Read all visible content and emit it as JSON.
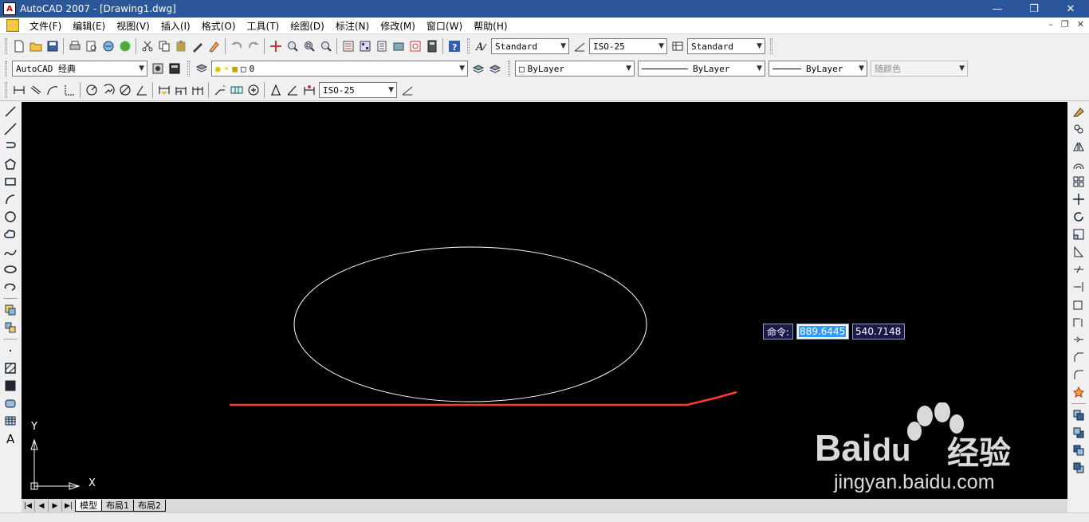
{
  "window": {
    "title": "AutoCAD 2007 - [Drawing1.dwg]",
    "app_icon_text": "A",
    "controls": {
      "minimize": "—",
      "maximize": "❐",
      "close": "✕"
    },
    "mdi_controls": {
      "minimize": "–",
      "restore": "❐",
      "close": "✕"
    }
  },
  "menu": {
    "items": [
      "文件(F)",
      "编辑(E)",
      "视图(V)",
      "插入(I)",
      "格式(O)",
      "工具(T)",
      "绘图(D)",
      "标注(N)",
      "修改(M)",
      "窗口(W)",
      "帮助(H)"
    ]
  },
  "toolbar_styles": {
    "text_style": "Standard",
    "dim_style": "ISO-25",
    "table_style": "Standard"
  },
  "toolbar_workspace": {
    "workspace": "AutoCAD 经典",
    "layer": "0",
    "color": "ByLayer",
    "linetype": "ByLayer",
    "lineweight": "ByLayer",
    "plotstyle": "随颜色"
  },
  "toolbar_dim": {
    "dim_style": "ISO-25"
  },
  "canvas": {
    "command_label": "命令:",
    "coord_x": "889.6445",
    "coord_y": "540.7148",
    "ucs_x": "X",
    "ucs_y": "Y",
    "ellipse_color": "#ffffff",
    "polyline_color": "#ff3b30",
    "background": "#000000"
  },
  "tabs": {
    "nav": [
      "|◀",
      "◀",
      "▶",
      "▶|"
    ],
    "items": [
      "模型",
      "布局1",
      "布局2"
    ],
    "active": "模型"
  },
  "watermark": {
    "brand": "Bai",
    "brand2": "du",
    "cn": "经验",
    "url": "jingyan.baidu.com"
  },
  "left_toolbar_icons": [
    "line-icon",
    "construction-line-icon",
    "polyline-icon",
    "polygon-icon",
    "rectangle-icon",
    "arc-icon",
    "circle-icon",
    "revision-cloud-icon",
    "spline-icon",
    "ellipse-icon",
    "ellipse-arc-icon",
    "insert-block-icon",
    "make-block-icon",
    "point-icon",
    "hatch-icon",
    "gradient-icon",
    "region-icon",
    "table-icon",
    "multiline-text-icon"
  ],
  "right_toolbar_icons": [
    "erase-icon",
    "copy-icon",
    "mirror-icon",
    "offset-icon",
    "array-icon",
    "move-icon",
    "rotate-icon",
    "scale-icon",
    "stretch-icon",
    "trim-icon",
    "extend-icon",
    "break-at-point-icon",
    "break-icon",
    "join-icon",
    "chamfer-icon",
    "fillet-icon",
    "explode-icon",
    "bring-to-front-icon",
    "send-to-back-icon",
    "bring-above-icon",
    "send-under-icon"
  ]
}
